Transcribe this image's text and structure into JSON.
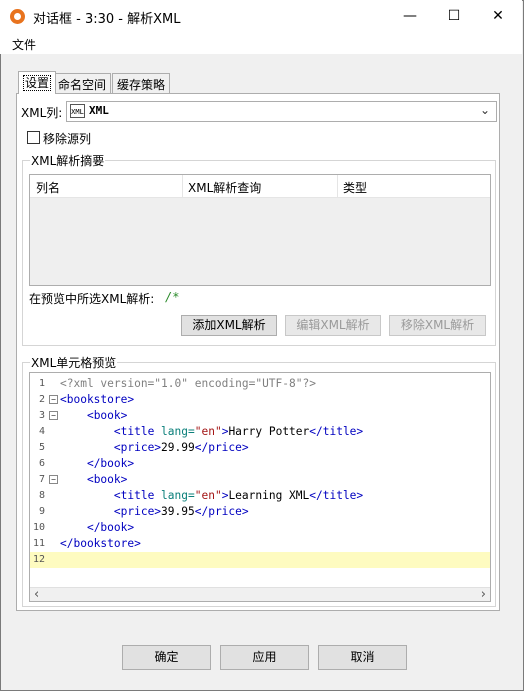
{
  "window": {
    "title": "对话框 - 3:30 - 解析XML",
    "minimize_glyph": "—",
    "maximize_glyph": "☐",
    "close_glyph": "✕",
    "icon": "app-icon",
    "accent": "#e8731e"
  },
  "menu": {
    "file": "文件"
  },
  "tabs": [
    {
      "label": "设置",
      "active": true
    },
    {
      "label": "命名空间",
      "active": false
    },
    {
      "label": "缓存策略",
      "active": false
    }
  ],
  "settings": {
    "xml_column_label": "XML列:",
    "xml_column_icon_text": "XML",
    "xml_column_value": "XML",
    "remove_source_label": "移除源列",
    "remove_source_checked": false
  },
  "summary": {
    "title": "XML解析摘要",
    "columns": [
      "列名",
      "XML解析查询",
      "类型"
    ],
    "rows": [],
    "preview_label": "在预览中所选XML解析:",
    "preview_value": "/*",
    "add_button": "添加XML解析",
    "edit_button": "编辑XML解析",
    "remove_button": "移除XML解析"
  },
  "preview": {
    "title": "XML单元格预览",
    "lines": [
      {
        "n": "1",
        "fold": "",
        "indent": "",
        "parts": [
          {
            "t": "<?xml version=\"1.0\" encoding=\"UTF-8\"?>",
            "c": "pi"
          }
        ]
      },
      {
        "n": "2",
        "fold": "−",
        "indent": "",
        "parts": [
          {
            "t": "<bookstore>",
            "c": "tag"
          }
        ]
      },
      {
        "n": "3",
        "fold": "−",
        "indent": "    ",
        "parts": [
          {
            "t": "<book>",
            "c": "tag"
          }
        ]
      },
      {
        "n": "4",
        "fold": "",
        "indent": "        ",
        "parts": [
          {
            "t": "<title ",
            "c": "tag"
          },
          {
            "t": "lang=",
            "c": "attr"
          },
          {
            "t": "\"en\"",
            "c": "val"
          },
          {
            "t": ">",
            "c": "tag"
          },
          {
            "t": "Harry Potter",
            "c": ""
          },
          {
            "t": "</title>",
            "c": "tag"
          }
        ]
      },
      {
        "n": "5",
        "fold": "",
        "indent": "        ",
        "parts": [
          {
            "t": "<price>",
            "c": "tag"
          },
          {
            "t": "29.99",
            "c": ""
          },
          {
            "t": "</price>",
            "c": "tag"
          }
        ]
      },
      {
        "n": "6",
        "fold": "",
        "indent": "    ",
        "parts": [
          {
            "t": "</book>",
            "c": "tag"
          }
        ]
      },
      {
        "n": "7",
        "fold": "−",
        "indent": "    ",
        "parts": [
          {
            "t": "<book>",
            "c": "tag"
          }
        ]
      },
      {
        "n": "8",
        "fold": "",
        "indent": "        ",
        "parts": [
          {
            "t": "<title ",
            "c": "tag"
          },
          {
            "t": "lang=",
            "c": "attr"
          },
          {
            "t": "\"en\"",
            "c": "val"
          },
          {
            "t": ">",
            "c": "tag"
          },
          {
            "t": "Learning XML",
            "c": ""
          },
          {
            "t": "</title>",
            "c": "tag"
          }
        ]
      },
      {
        "n": "9",
        "fold": "",
        "indent": "        ",
        "parts": [
          {
            "t": "<price>",
            "c": "tag"
          },
          {
            "t": "39.95",
            "c": ""
          },
          {
            "t": "</price>",
            "c": "tag"
          }
        ]
      },
      {
        "n": "10",
        "fold": "",
        "indent": "    ",
        "parts": [
          {
            "t": "</book>",
            "c": "tag"
          }
        ]
      },
      {
        "n": "11",
        "fold": "",
        "indent": "",
        "parts": [
          {
            "t": "</bookstore>",
            "c": "tag"
          }
        ]
      },
      {
        "n": "12",
        "fold": "",
        "indent": "",
        "parts": [],
        "highlight": true
      }
    ],
    "scroll_left": "‹",
    "scroll_right": "›"
  },
  "footer": {
    "ok": "确定",
    "apply": "应用",
    "cancel": "取消"
  }
}
